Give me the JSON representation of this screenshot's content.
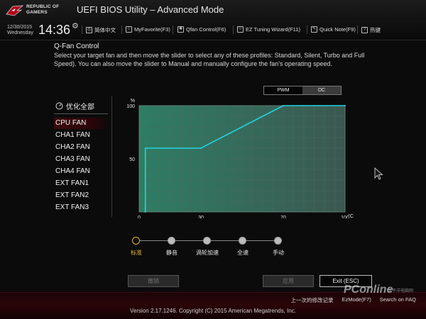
{
  "header": {
    "logo_lines": [
      "REPUBLIC OF",
      "GAMERS"
    ],
    "app_title": "UEFI BIOS Utility – Advanced Mode",
    "date": "12/30/2015",
    "weekday": "Wednesday",
    "time": "14:36",
    "items": [
      {
        "icon": "globe-icon",
        "label": "简体中文"
      },
      {
        "icon": "favorite-icon",
        "label": "MyFavorite(F3)"
      },
      {
        "icon": "fan-icon",
        "label": "Qfan Control(F6)"
      },
      {
        "icon": "tuning-icon",
        "label": "EZ Tuning Wizard(F11)"
      },
      {
        "icon": "note-icon",
        "label": "Quick Note(F9)"
      },
      {
        "icon": "help-icon",
        "label": "热键"
      }
    ]
  },
  "main": {
    "section_title": "Q-Fan Control",
    "description": "Select your target fan and then move the slider to select any of these profiles: Standard, Silent, Turbo and Full Speed). You can also move the slider to Manual and manually configure the fan's operating speed.",
    "fan_list_header": "优化全部",
    "fans": [
      "CPU FAN",
      "CHA1 FAN",
      "CHA2 FAN",
      "CHA3 FAN",
      "CHA4 FAN",
      "EXT FAN1",
      "EXT FAN2",
      "EXT FAN3"
    ],
    "selected_fan": "CPU FAN",
    "mode_toggle": {
      "pwm": "PWM",
      "dc": "DC",
      "selected": "PWM"
    },
    "profiles": [
      "标准",
      "静音",
      "渦轮加速",
      "全速",
      "手动"
    ],
    "selected_profile": "标准"
  },
  "buttons": {
    "undo": "撤销",
    "apply": "应用",
    "exit": "Exit (ESC)"
  },
  "footer": {
    "links": [
      "上一次的修改记录",
      "EzMode(F7)",
      "Search on FAQ"
    ],
    "version": "Version 2.17.1246. Copyright (C) 2015 American Megatrends, Inc."
  },
  "watermark": {
    "text": "PConline",
    "sub": "太平洋电脑网"
  },
  "colors": {
    "curve": "#22d3e6",
    "plot_fill": "#2a7a62",
    "accent": "#e2b33a",
    "grid": "#4a6a5e"
  },
  "chart_data": {
    "type": "line",
    "x_unit": "°C",
    "y_unit": "%",
    "xlim": [
      0,
      100
    ],
    "ylim": [
      0,
      100
    ],
    "x_ticks": [
      0,
      30,
      70,
      100
    ],
    "y_ticks": [
      50,
      100
    ],
    "grid": true,
    "series": [
      {
        "x": [
          3,
          3,
          30,
          70,
          100
        ],
        "y": [
          0,
          60,
          60,
          100,
          100
        ]
      }
    ]
  }
}
